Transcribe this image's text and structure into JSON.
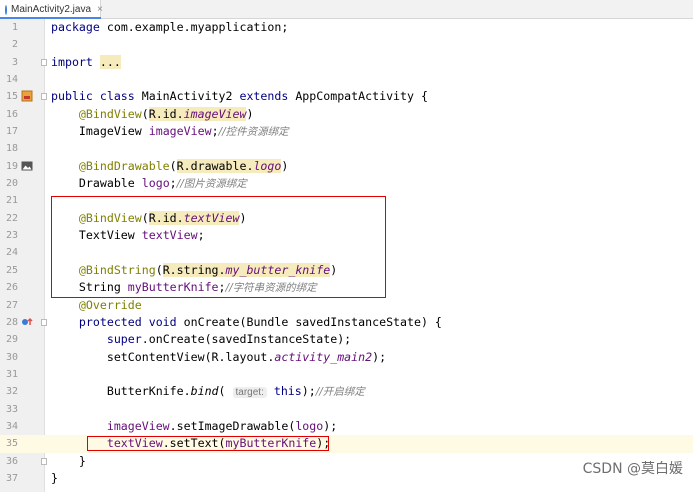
{
  "tab": {
    "label": "MainActivity2.java",
    "close": "×"
  },
  "lines": [
    {
      "n": "1"
    },
    {
      "n": "2"
    },
    {
      "n": "3"
    },
    {
      "n": "14"
    },
    {
      "n": "15"
    },
    {
      "n": "16"
    },
    {
      "n": "17"
    },
    {
      "n": "18"
    },
    {
      "n": "19"
    },
    {
      "n": "20"
    },
    {
      "n": "21"
    },
    {
      "n": "22"
    },
    {
      "n": "23"
    },
    {
      "n": "24"
    },
    {
      "n": "25"
    },
    {
      "n": "26"
    },
    {
      "n": "27"
    },
    {
      "n": "28"
    },
    {
      "n": "29"
    },
    {
      "n": "30"
    },
    {
      "n": "31"
    },
    {
      "n": "32"
    },
    {
      "n": "33"
    },
    {
      "n": "34"
    },
    {
      "n": "35"
    },
    {
      "n": "36"
    },
    {
      "n": "37"
    }
  ],
  "code": {
    "l1_kw": "package",
    "l1_rest": " com.example.myapplication;",
    "l3_kw": "import",
    "l3_fold": "...",
    "l15_kw": "public class",
    "l15_name": " MainActivity2 ",
    "l15_ext": "extends",
    "l15_rest": " AppCompatActivity {",
    "l16_ann": "@BindView",
    "l16_arg": "R.id.",
    "l16_field": "imageView",
    "l17_type": "ImageView ",
    "l17_field": "imageView",
    "l17_cmt": "//控件资源绑定",
    "l19_ann": "@BindDrawable",
    "l19_arg": "R.drawable.",
    "l19_field": "logo",
    "l20_type": "Drawable ",
    "l20_field": "logo",
    "l20_cmt": "//图片资源绑定",
    "l22_ann": "@BindView",
    "l22_arg": "R.id.",
    "l22_field": "textView",
    "l23_type": "TextView ",
    "l23_field": "textView",
    "l25_ann": "@BindString",
    "l25_arg": "R.string.",
    "l25_field": "my_butter_knife",
    "l26_type": "String ",
    "l26_field": "myButterKnife",
    "l26_cmt": "//字符串资源的绑定",
    "l27_ann": "@Override",
    "l28_kw": "protected void",
    "l28_name": " onCreate",
    "l28_rest": "(Bundle savedInstanceState) {",
    "l29_kw": "super",
    "l29_rest": ".onCreate(savedInstanceState);",
    "l30_a": "setContentView(R.layout.",
    "l30_field": "activity_main2",
    "l30_b": ");",
    "l32_a": "ButterKnife.",
    "l32_m": "bind",
    "l32_hint": "target:",
    "l32_kw": "this",
    "l32_b": ");",
    "l32_cmt": "//开启绑定",
    "l34_field": "imageView",
    "l34_a": ".setImageDrawable(",
    "l34_field2": "logo",
    "l34_b": ");",
    "l35_field": "textView",
    "l35_a": ".setText(",
    "l35_field2": "myButterKnife",
    "l35_b": ");",
    "l36": "}",
    "l37": "}"
  },
  "watermark": "CSDN @莫白媛"
}
